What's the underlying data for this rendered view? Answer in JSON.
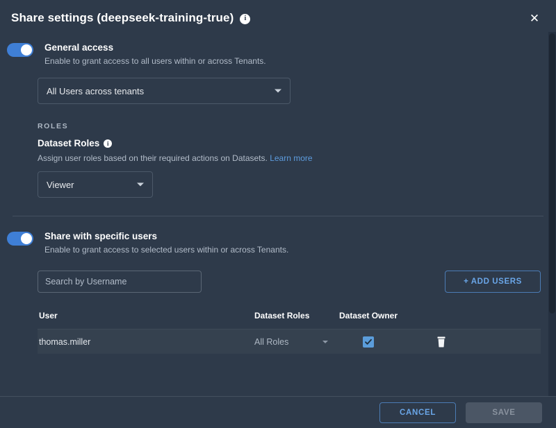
{
  "header": {
    "title": "Share settings (deepseek-training-true)",
    "info_icon": "info-icon",
    "close_icon": "✕"
  },
  "general_access": {
    "title": "General access",
    "description": "Enable to grant access to all users within or across Tenants.",
    "toggle_state": "on",
    "access_select": {
      "value": "All Users across tenants"
    }
  },
  "roles": {
    "section_label": "ROLES",
    "dataset_roles_title": "Dataset Roles",
    "dataset_roles_desc": "Assign user roles based on their required actions on Datasets.",
    "learn_more": "Learn more",
    "role_select": {
      "value": "Viewer"
    }
  },
  "specific_users": {
    "title": "Share with specific users",
    "description": "Enable to grant access to selected users within or across Tenants.",
    "toggle_state": "on",
    "search": {
      "placeholder": "Search by Username",
      "value": ""
    },
    "add_users_label": "+ ADD USERS"
  },
  "table": {
    "columns": [
      "User",
      "Dataset Roles",
      "Dataset Owner"
    ],
    "rows": [
      {
        "user": "thomas.miller",
        "dataset_roles": "All Roles",
        "dataset_owner_checked": true
      }
    ]
  },
  "footer": {
    "cancel_label": "CANCEL",
    "save_label": "SAVE",
    "save_enabled": false
  },
  "colors": {
    "background": "#2e3a4a",
    "row_background": "#35414f",
    "accent_blue": "#3f7fd6",
    "link_blue": "#5d9cde",
    "checkbox_blue": "#5b9ddb",
    "divider": "#44505f"
  }
}
